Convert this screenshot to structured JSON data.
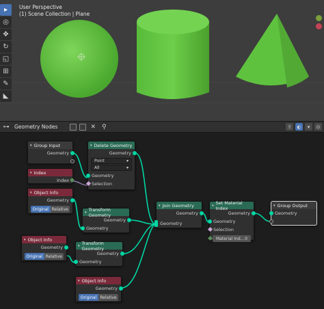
{
  "viewport": {
    "perspective_label": "User Perspective",
    "collection_label": "(1) Scene Collection | Plane",
    "object_color": "#62c443",
    "background": "#3d3d3d"
  },
  "toolbar": {
    "tools": [
      "select-box-icon",
      "cursor-icon",
      "move-icon",
      "rotate-icon",
      "scale-icon",
      "transform-icon",
      "annotate-icon",
      "measure-icon"
    ]
  },
  "header": {
    "editor_type_icon": "node-editor-icon",
    "tree_name": "Geometry Nodes"
  },
  "nodes": {
    "group_input": {
      "title": "Group Input",
      "geometry": "Geometry"
    },
    "index": {
      "title": "Index",
      "index": "Index"
    },
    "object_info_1": {
      "title": "Object Info",
      "geometry": "Geometry",
      "original": "Original",
      "relative": "Relative"
    },
    "object_info_2": {
      "title": "Object Info",
      "geometry": "Geometry",
      "original": "Original",
      "relative": "Relative"
    },
    "object_info_3": {
      "title": "Object Info",
      "geometry": "Geometry",
      "original": "Original",
      "relative": "Relative"
    },
    "delete_geometry": {
      "title": "Delete Geometry",
      "geometry_out": "Geometry",
      "domain": "Point",
      "mode": "All",
      "geometry_in": "Geometry",
      "selection": "Selection"
    },
    "transform_1": {
      "title": "Transform Geometry",
      "geometry_out": "Geometry",
      "geometry_in": "Geometry"
    },
    "transform_2": {
      "title": "Transform Geometry",
      "geometry_out": "Geometry",
      "geometry_in": "Geometry"
    },
    "join": {
      "title": "Join Geometry",
      "geometry_out": "Geometry",
      "geometry_in": "Geometry"
    },
    "set_material_index": {
      "title": "Set Material Index",
      "geometry_out": "Geometry",
      "geometry_in": "Geometry",
      "selection": "Selection",
      "material_index_label": "Material Ind...",
      "material_index_value": "0"
    },
    "group_output": {
      "title": "Group Output",
      "geometry": "Geometry"
    }
  },
  "colors": {
    "geometry_socket": "#00d6a3",
    "input_header": "#7a2a3a",
    "geometry_header": "#2a6b55",
    "accent": "#4772b3"
  }
}
